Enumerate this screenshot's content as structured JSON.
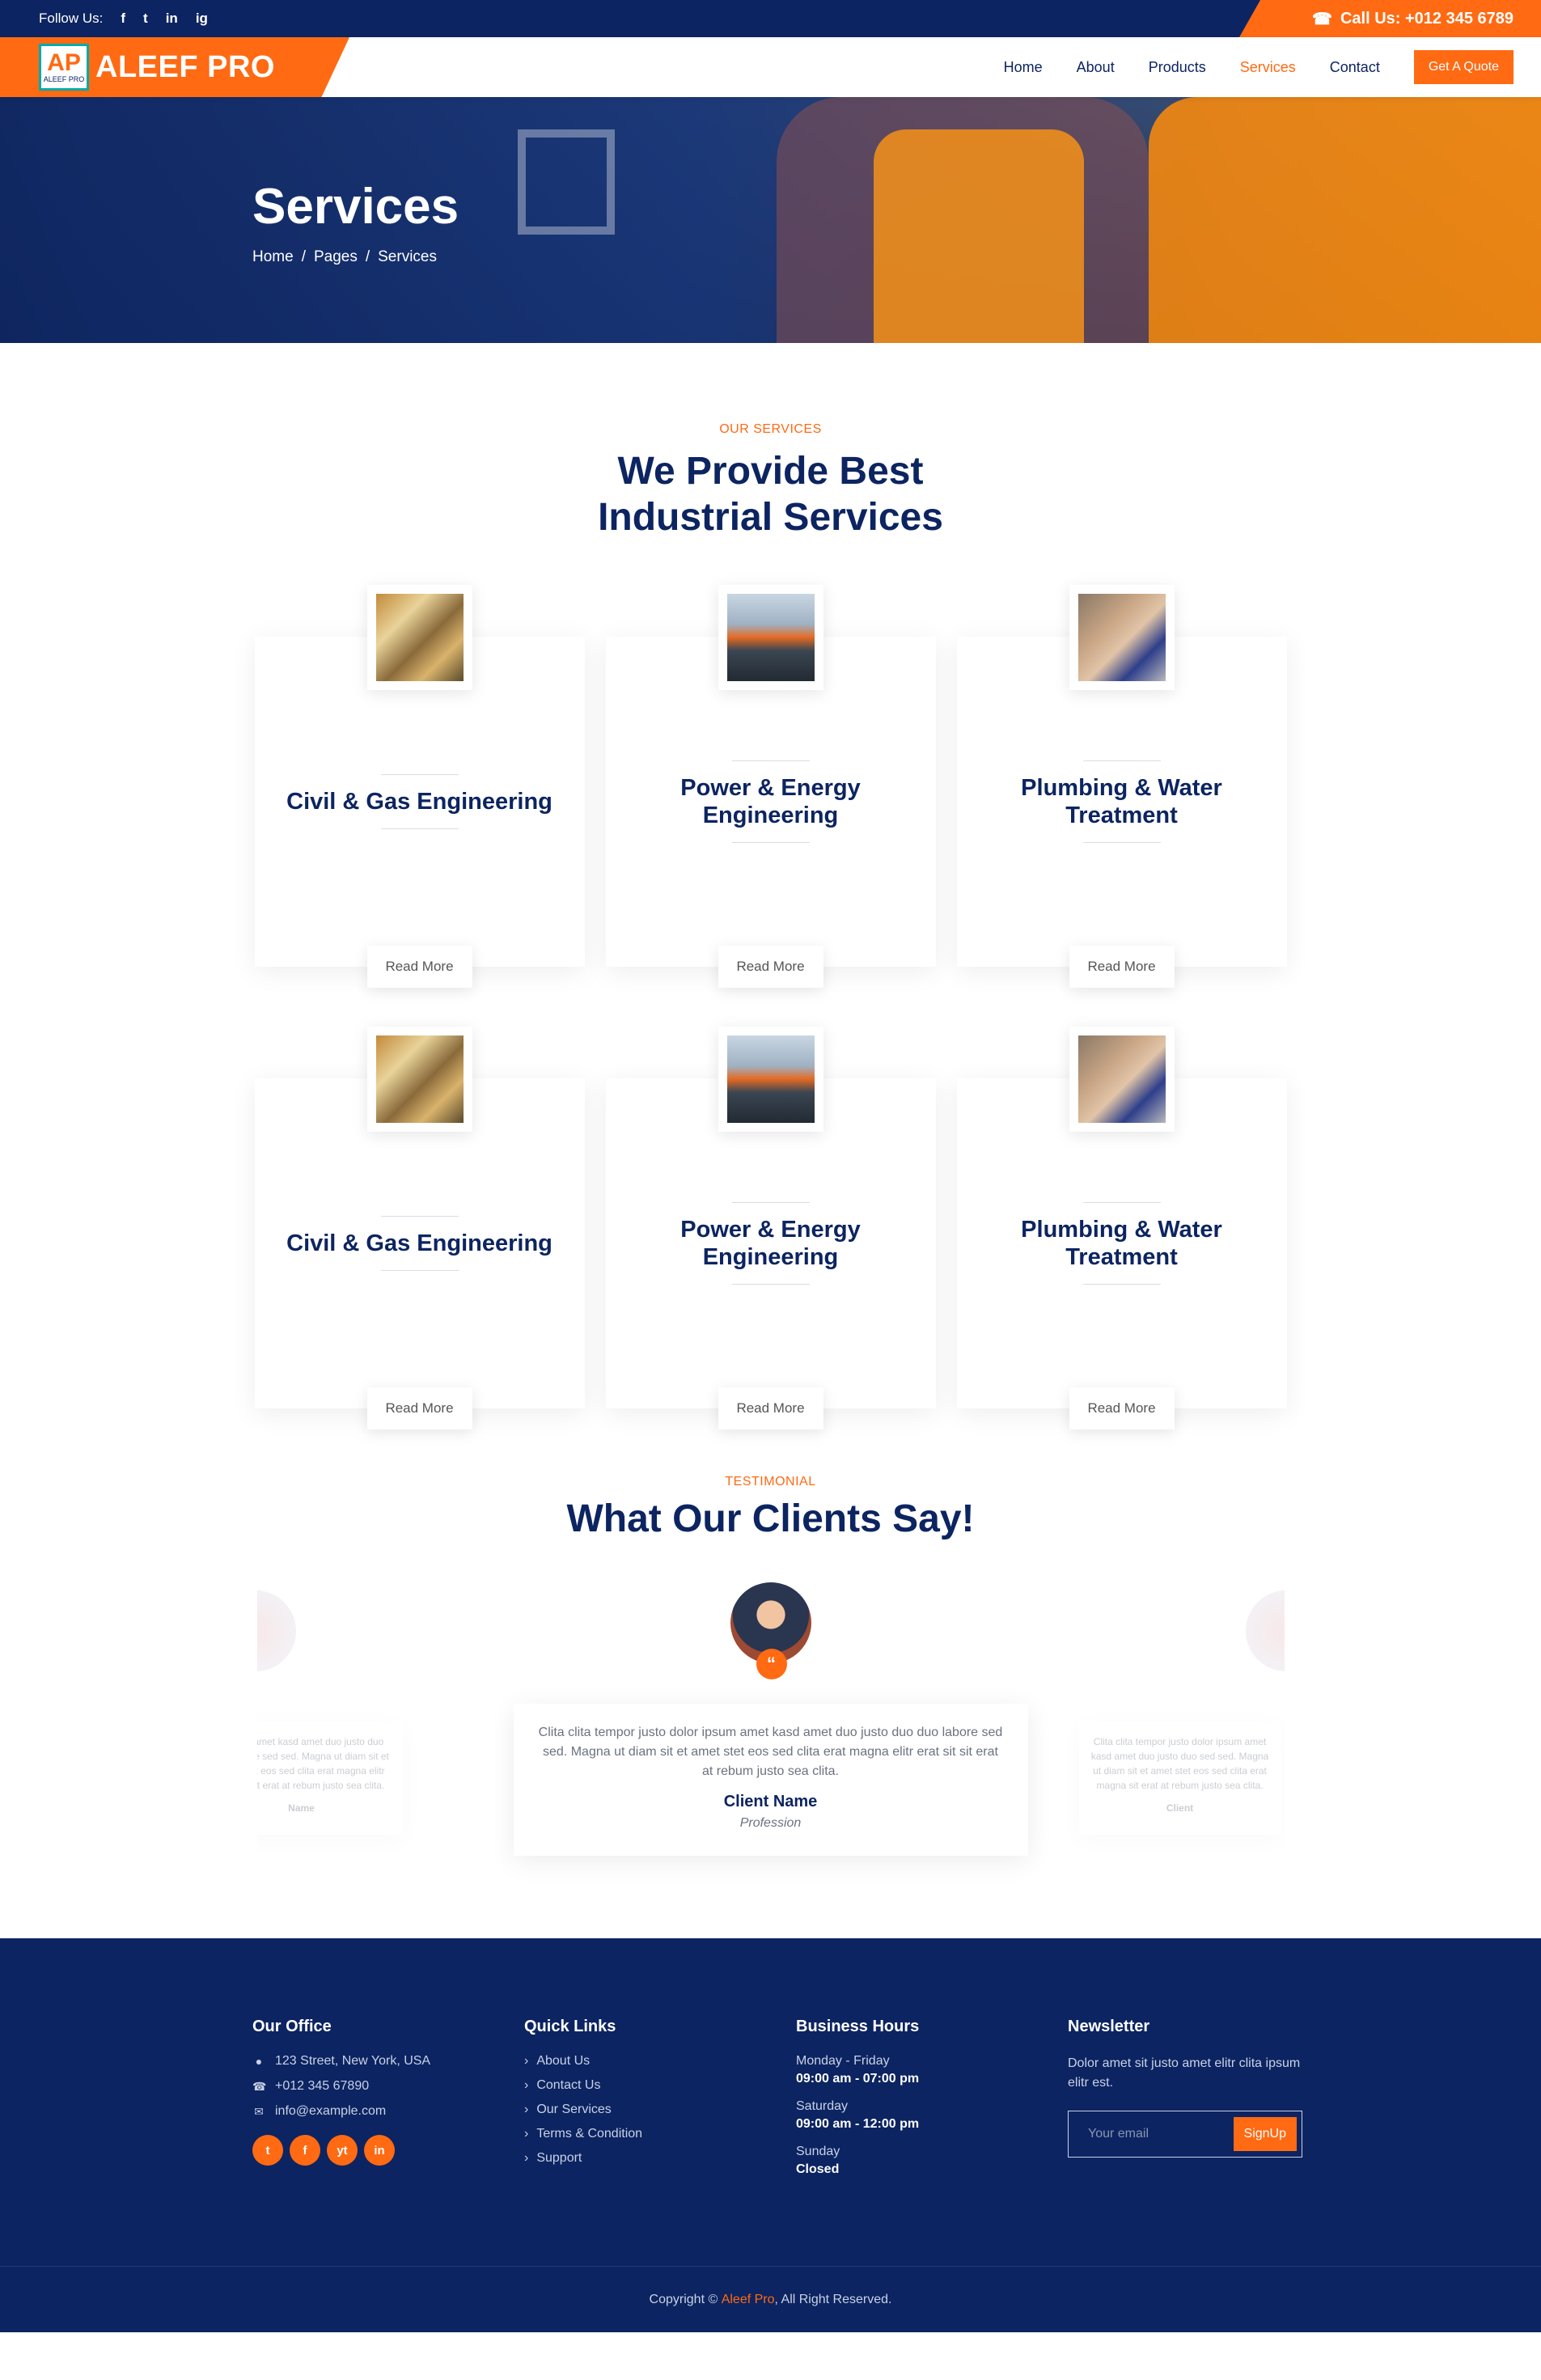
{
  "topbar": {
    "follow_label": "Follow Us:",
    "socials": [
      "f",
      "t",
      "in",
      "ig"
    ],
    "call_label": "Call Us: +012 345 6789"
  },
  "navbar": {
    "logo_text": "AP",
    "logo_sub": "ALEEF PRO",
    "brand": "ALEEF PRO",
    "menu": [
      "Home",
      "About",
      "Products",
      "Services",
      "Contact"
    ],
    "active_item": "Services",
    "quote_button": "Get A Quote"
  },
  "hero": {
    "title": "Services",
    "breadcrumb": [
      "Home",
      "Pages",
      "Services"
    ],
    "separator": "/"
  },
  "services": {
    "label": "OUR SERVICES",
    "title_line1": "We Provide Best",
    "title_line2": "Industrial Services",
    "cards": [
      {
        "title": "Civil & Gas Engineering",
        "image": "civil-engineering-photo",
        "button": "Read More"
      },
      {
        "title": "Power & Energy Engineering",
        "image": "power-energy-photo",
        "button": "Read More"
      },
      {
        "title": "Plumbing & Water Treatment",
        "image": "plumbing-photo",
        "button": "Read More"
      },
      {
        "title": "Civil & Gas Engineering",
        "image": "civil-engineering-photo",
        "button": "Read More"
      },
      {
        "title": "Power & Energy Engineering",
        "image": "power-energy-photo",
        "button": "Read More"
      },
      {
        "title": "Plumbing & Water Treatment",
        "image": "plumbing-photo",
        "button": "Read More"
      }
    ]
  },
  "testimonial": {
    "label": "TESTIMONIAL",
    "title": "What Our Clients Say!",
    "quote_icon": "“",
    "text": "Clita clita tempor justo dolor ipsum amet kasd amet duo justo duo duo labore sed sed. Magna ut diam sit et amet stet eos sed clita erat magna elitr erat sit sit erat at rebum justo sea clita.",
    "client_name": "Client Name",
    "profession": "Profession",
    "side_text_left": "r ipsum amet kasd amet duo justo duo duo labore sed sed. Magna ut diam sit et amet stet eos sed clita erat magna elitr erat sit sit erat at rebum justo sea clita.",
    "side_name_left": "Name",
    "side_text_right": "Clita clita tempor justo dolor ipsum amet kasd amet duo justo duo sed sed. Magna ut diam sit et amet stet eos sed clita erat magna sit erat at rebum justo sea clita.",
    "side_name_right": "Client"
  },
  "footer": {
    "office": {
      "heading": "Our Office",
      "address": "123 Street, New York, USA",
      "phone": "+012 345 67890",
      "email": "info@example.com",
      "socials": [
        "t",
        "f",
        "yt",
        "in"
      ]
    },
    "quick_links": {
      "heading": "Quick Links",
      "links": [
        "About Us",
        "Contact Us",
        "Our Services",
        "Terms & Condition",
        "Support"
      ]
    },
    "hours": {
      "heading": "Business Hours",
      "rows": [
        {
          "day": "Monday - Friday",
          "time": "09:00 am - 07:00 pm"
        },
        {
          "day": "Saturday",
          "time": "09:00 am - 12:00 pm"
        },
        {
          "day": "Sunday",
          "time": "Closed"
        }
      ]
    },
    "newsletter": {
      "heading": "Newsletter",
      "text": "Dolor amet sit justo amet elitr clita ipsum elitr est.",
      "placeholder": "Your email",
      "button": "SignUp"
    },
    "copyright_prefix": "Copyright ©",
    "copyright_brand": "Aleef Pro",
    "copyright_suffix": ", All Right Reserved."
  },
  "colors": {
    "navy": "#0c2461",
    "orange": "#ff6a13"
  }
}
